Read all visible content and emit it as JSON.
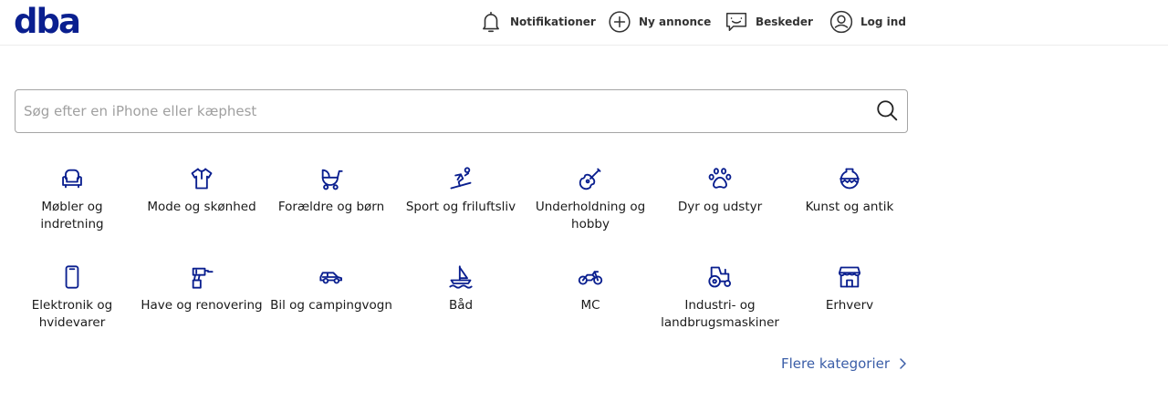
{
  "brand": {
    "logo_text": "dba",
    "accent_color": "#0a1f8f",
    "link_color": "#3b5ea8"
  },
  "header": {
    "nav": [
      {
        "label": "Notifikationer",
        "icon": "bell-icon"
      },
      {
        "label": "Ny annonce",
        "icon": "plus-circle-icon"
      },
      {
        "label": "Beskeder",
        "icon": "chat-icon"
      },
      {
        "label": "Log ind",
        "icon": "user-circle-icon"
      }
    ]
  },
  "search": {
    "placeholder": "Søg efter en iPhone eller kæphest",
    "value": "",
    "icon": "search-icon"
  },
  "categories": [
    {
      "label": "Møbler og indretning",
      "icon": "armchair-icon"
    },
    {
      "label": "Mode og skønhed",
      "icon": "shirt-icon"
    },
    {
      "label": "Forældre og børn",
      "icon": "stroller-icon"
    },
    {
      "label": "Sport og friluftsliv",
      "icon": "skier-icon"
    },
    {
      "label": "Underholdning og hobby",
      "icon": "guitar-icon"
    },
    {
      "label": "Dyr og udstyr",
      "icon": "paw-icon"
    },
    {
      "label": "Kunst og antik",
      "icon": "vase-icon"
    },
    {
      "label": "Elektronik og hvidevarer",
      "icon": "smartphone-icon"
    },
    {
      "label": "Have og renovering",
      "icon": "drill-icon"
    },
    {
      "label": "Bil og campingvogn",
      "icon": "car-icon"
    },
    {
      "label": "Båd",
      "icon": "boat-icon"
    },
    {
      "label": "MC",
      "icon": "motorcycle-icon"
    },
    {
      "label": "Industri- og landbrugsmaskiner",
      "icon": "tractor-icon"
    },
    {
      "label": "Erhverv",
      "icon": "store-icon"
    }
  ],
  "more_link": {
    "label": "Flere kategorier",
    "icon": "chevron-right-icon"
  }
}
